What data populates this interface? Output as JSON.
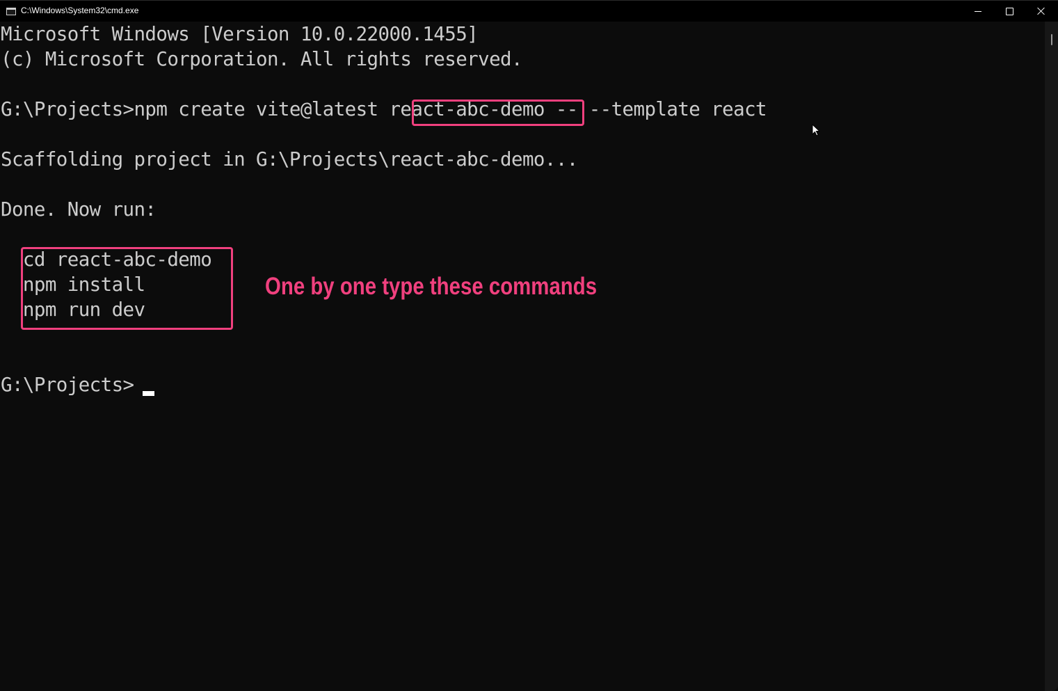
{
  "window": {
    "title": "C:\\Windows\\System32\\cmd.exe",
    "icon": "cmd-app-icon",
    "icon_text": "C:\\_",
    "controls": {
      "minimize": "minimize-icon",
      "maximize": "maximize-icon",
      "close": "close-icon"
    }
  },
  "console": {
    "lines": [
      "Microsoft Windows [Version 10.0.22000.1455]",
      "(c) Microsoft Corporation. All rights reserved.",
      "",
      "G:\\Projects>npm create vite@latest react-abc-demo -- --template react",
      "",
      "Scaffolding project in G:\\Projects\\react-abc-demo...",
      "",
      "Done. Now run:",
      "",
      "  cd react-abc-demo",
      "  npm install",
      "  npm run dev",
      "",
      "",
      "G:\\Projects>"
    ],
    "highlighted_project_name": "react-abc-demo",
    "prompt": "G:\\Projects>",
    "cursor": "block-cursor"
  },
  "annotation": {
    "text": "One by one type these commands",
    "color": "#f0407e"
  },
  "colors": {
    "background": "#0c0c0c",
    "foreground": "#cccccc",
    "highlight": "#f0407e",
    "titlebar": "#000000"
  }
}
